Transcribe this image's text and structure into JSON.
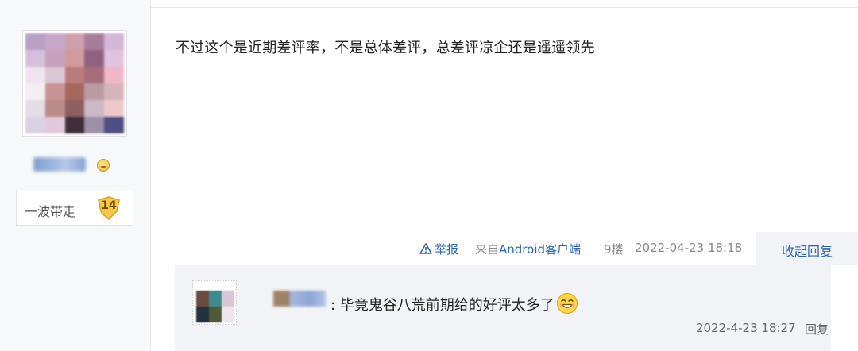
{
  "author": {
    "fan_badge_label": "一波带走",
    "fan_level": "14"
  },
  "post": {
    "content": "不过这个是近期差评率，不是总体差评，总差评凉企还是遥遥领先",
    "report_label": "举报",
    "source_prefix": "来自",
    "source_client": "Android客户端",
    "floor": "9楼",
    "time": "2022-04-23 18:18",
    "collapse_label": "收起回复"
  },
  "reply": {
    "text": ": 毕竟鬼谷八荒前期给的好评太多了",
    "time": "2022-4-23 18:27",
    "reply_label": "回复",
    "emoji": "smiling-face-emoji"
  },
  "colors": {
    "link": "#2d64b3",
    "sidebar_bg": "#f7f8fa",
    "reply_bg": "#f2f3f7"
  }
}
